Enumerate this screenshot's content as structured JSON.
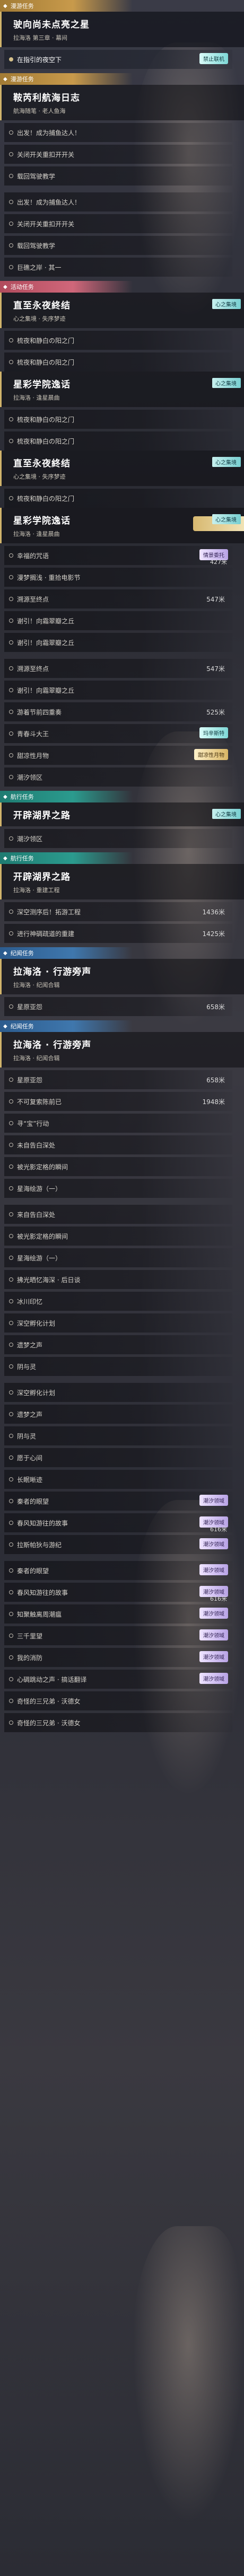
{
  "rows": [
    {
      "kind": "header",
      "cls": "gold",
      "icon": "◆",
      "title": "漫游任务"
    },
    {
      "kind": "card",
      "title": "驶向尚未点亮之星",
      "sub": "拉海洛 第三章 · 幕间",
      "hl": true
    },
    {
      "kind": "step",
      "label": "在指引的夜空下",
      "active": true,
      "tag": "禁止联机",
      "tagcls": "cyan"
    },
    {
      "kind": "gap"
    },
    {
      "kind": "header",
      "cls": "gold",
      "icon": "◆",
      "title": "漫游任务"
    },
    {
      "kind": "card",
      "title": "鞍芮利航海日志",
      "sub": "航海随笔 · 老人鱼海"
    },
    {
      "kind": "step",
      "label": "出发！成为捕鱼达人！",
      "active": false
    },
    {
      "kind": "step",
      "label": "关闭开关重扣开开关",
      "active": false
    },
    {
      "kind": "step",
      "label": "载回驾驶教学",
      "active": false
    },
    {
      "kind": "gap"
    },
    {
      "kind": "step",
      "label": "出发！成为捕鱼达人！",
      "active": false
    },
    {
      "kind": "step",
      "label": "关闭开关重扣开开关",
      "active": false
    },
    {
      "kind": "step",
      "label": "载回驾驶教学",
      "active": false
    },
    {
      "kind": "step",
      "label": "巨礁之岸 · 其一",
      "active": false
    },
    {
      "kind": "gap"
    },
    {
      "kind": "header",
      "cls": "pink",
      "icon": "◆",
      "title": "活动任务"
    },
    {
      "kind": "card",
      "title": "直至永夜終结",
      "sub": "心之集境 · 失序梦迹",
      "badge": "心之集境",
      "badgecls": "cyan"
    },
    {
      "kind": "step",
      "label": "梳夜和静白の阳之门",
      "active": false
    },
    {
      "kind": "step",
      "label": "梳夜和静白の阳之门",
      "active": false
    },
    {
      "kind": "card",
      "title": "星彩学院逸话",
      "sub": "拉海洛 · 逢星晨曲",
      "badge": "心之集境",
      "badgecls": "cyan"
    },
    {
      "kind": "step",
      "label": "梳夜和静白の阳之门",
      "active": false
    },
    {
      "kind": "step",
      "label": "梳夜和静白の阳之门",
      "active": false
    },
    {
      "kind": "card",
      "title": "直至永夜終结",
      "sub": "心之集境 · 失序梦迹",
      "badge": "心之集境",
      "badgecls": "cyan"
    },
    {
      "kind": "step",
      "label": "梳夜和静白の阳之门",
      "active": false
    },
    {
      "kind": "card",
      "title": "星彩学院逸话",
      "sub": "拉海洛 · 逢星晨曲",
      "badge": "心之集境",
      "badgecls": "cyan",
      "banner": true
    },
    {
      "kind": "step",
      "label": "幸福的咒语",
      "active": false,
      "tag": "情景委托",
      "tagcls": "purple",
      "tagdist": "427米"
    },
    {
      "kind": "step",
      "label": "漫梦搁浅 · 重拾电影节",
      "active": false
    },
    {
      "kind": "step",
      "label": "溯源至终点",
      "active": false,
      "dist": "547米"
    },
    {
      "kind": "step",
      "label": "谢引！向霜翠瓣之丘",
      "active": false
    },
    {
      "kind": "step",
      "label": "谢引！向霜翠瓣之丘",
      "active": false
    },
    {
      "kind": "gap"
    },
    {
      "kind": "step",
      "label": "溯源至终点",
      "active": false,
      "dist": "547米"
    },
    {
      "kind": "step",
      "label": "谢引！向霜翠瓣之丘",
      "active": false
    },
    {
      "kind": "step",
      "label": "游着节前四重奏",
      "active": false,
      "dist": "525米"
    },
    {
      "kind": "step",
      "label": "青春斗大王",
      "active": false,
      "tag": "玛辛斯特",
      "tagcls": "cyan"
    },
    {
      "kind": "step",
      "label": "甜凉性月物",
      "active": false,
      "tag": "甜凉性月物",
      "tagcls": "gold"
    },
    {
      "kind": "step",
      "label": "潮汐领区",
      "active": false
    },
    {
      "kind": "gap"
    },
    {
      "kind": "header",
      "cls": "teal",
      "icon": "◆",
      "title": "航行任务"
    },
    {
      "kind": "card",
      "title": "开辟湖界之路",
      "sub": "",
      "badge": "心之集境",
      "badgecls": "cyan"
    },
    {
      "kind": "step",
      "label": "潮汐领区",
      "active": false
    },
    {
      "kind": "gap"
    },
    {
      "kind": "header",
      "cls": "teal",
      "icon": "◆",
      "title": "航行任务"
    },
    {
      "kind": "card",
      "title": "开辟湖界之路",
      "sub": "拉海洛 · 重建工程"
    },
    {
      "kind": "step",
      "label": "深空测序后！拓游工程",
      "active": false,
      "dist": "1436米"
    },
    {
      "kind": "step",
      "label": "进行神碉疏道的重建",
      "active": false,
      "dist": "1425米"
    },
    {
      "kind": "gap"
    },
    {
      "kind": "header",
      "cls": "blue",
      "icon": "◆",
      "title": "纪闻任务"
    },
    {
      "kind": "card",
      "title": "拉海洛 · 行游旁声",
      "sub": "拉海洛 · 纪闻合辑"
    },
    {
      "kind": "step",
      "label": "星原亚怨",
      "active": false,
      "dist": "658米"
    },
    {
      "kind": "gap"
    },
    {
      "kind": "header",
      "cls": "blue",
      "icon": "◆",
      "title": "纪闻任务"
    },
    {
      "kind": "card",
      "title": "拉海洛 · 行游旁声",
      "sub": "拉海洛 · 纪闻合辑"
    },
    {
      "kind": "step",
      "label": "星原亚怨",
      "active": false,
      "dist": "658米"
    },
    {
      "kind": "step",
      "label": "不可复索陈前已",
      "active": false,
      "dist": "1948米"
    },
    {
      "kind": "step",
      "label": "寻“宝”行动",
      "active": false
    },
    {
      "kind": "step",
      "label": "未自告白深处",
      "active": false
    },
    {
      "kind": "step",
      "label": "被光影定格的瞬间",
      "active": false
    },
    {
      "kind": "step",
      "label": "星海绘游（一）",
      "active": false
    },
    {
      "kind": "gap"
    },
    {
      "kind": "step",
      "label": "来自告白深处",
      "active": false
    },
    {
      "kind": "step",
      "label": "被光影定格的瞬间",
      "active": false
    },
    {
      "kind": "step",
      "label": "星海绘游（一）",
      "active": false
    },
    {
      "kind": "step",
      "label": "拂光晒忆海深 · 后日谈",
      "active": false
    },
    {
      "kind": "step",
      "label": "冰川印忆",
      "active": false
    },
    {
      "kind": "step",
      "label": "深空孵化计划",
      "active": false
    },
    {
      "kind": "step",
      "label": "遗梦之声",
      "active": false
    },
    {
      "kind": "step",
      "label": "阴与灵",
      "active": false
    },
    {
      "kind": "gap"
    },
    {
      "kind": "step",
      "label": "深空孵化计划",
      "active": false
    },
    {
      "kind": "step",
      "label": "遗梦之声",
      "active": false
    },
    {
      "kind": "step",
      "label": "阴与灵",
      "active": false
    },
    {
      "kind": "step",
      "label": "愿于心间",
      "active": false
    },
    {
      "kind": "step",
      "label": "长眠晰迹",
      "active": false
    },
    {
      "kind": "step",
      "label": "秦者的眼望",
      "active": false,
      "tag": "潮汐领域",
      "tagcls": "purple"
    },
    {
      "kind": "step",
      "label": "春风知游往的故事",
      "active": false,
      "tag": "潮汐领域",
      "tagcls": "purple",
      "tagdist": "616米"
    },
    {
      "kind": "step",
      "label": "拉斯帕狄与游纪",
      "active": false,
      "tag": "潮汐领域",
      "tagcls": "purple"
    },
    {
      "kind": "gap"
    },
    {
      "kind": "step",
      "label": "秦者的眼望",
      "active": false,
      "tag": "潮汐领域",
      "tagcls": "purple"
    },
    {
      "kind": "step",
      "label": "春风知游往的故事",
      "active": false,
      "tag": "潮汐领域",
      "tagcls": "purple",
      "tagdist": "616米"
    },
    {
      "kind": "step",
      "label": "知聚触离周潮瘟",
      "active": false,
      "tag": "潮汐领域",
      "tagcls": "purple"
    },
    {
      "kind": "step",
      "label": "三千里望",
      "active": false,
      "tag": "潮汐领域",
      "tagcls": "purple"
    },
    {
      "kind": "step",
      "label": "我的消防",
      "active": false,
      "tag": "潮汐领域",
      "tagcls": "purple"
    },
    {
      "kind": "step",
      "label": "心碉跳动之声 · 搞话翻译",
      "active": false,
      "tag": "潮汐领域",
      "tagcls": "purple"
    },
    {
      "kind": "step",
      "label": "奇怪的三兄弟 · 沃德女",
      "active": false
    },
    {
      "kind": "step",
      "label": "奇怪的三兄弟 · 沃德女",
      "active": false
    }
  ]
}
